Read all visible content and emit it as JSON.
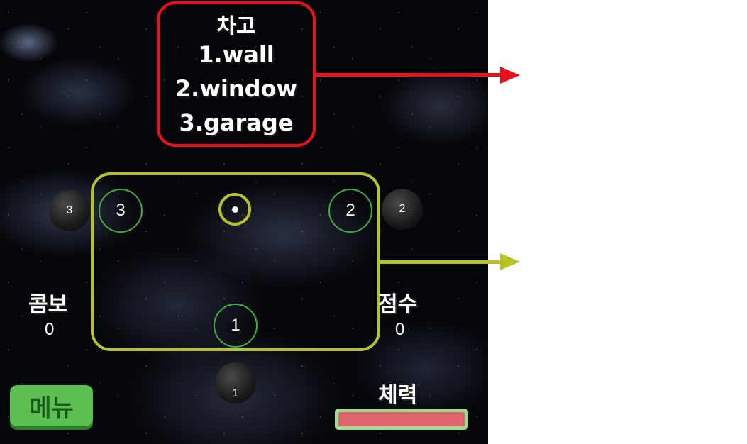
{
  "hint": {
    "title": "차고",
    "items": [
      "1.wall",
      "2.window",
      "3.garage"
    ]
  },
  "lanes": {
    "left": {
      "ring_number": "3",
      "rock_number": "3"
    },
    "right": {
      "ring_number": "2",
      "rock_number": "2"
    },
    "bottom": {
      "ring_number": "1",
      "rock_number": "1"
    }
  },
  "hud": {
    "combo_label": "콤보",
    "combo_value": "0",
    "score_label": "점수",
    "score_value": "0",
    "hp_label": "체력",
    "hp_fraction": 1.0
  },
  "menu": {
    "label": "메뉴"
  },
  "colors": {
    "hint_border": "#e8101a",
    "play_border": "#b5c229",
    "ring": "#3fae3f",
    "hp_fill": "#e0636e",
    "menu_button": "#5bbf52"
  }
}
